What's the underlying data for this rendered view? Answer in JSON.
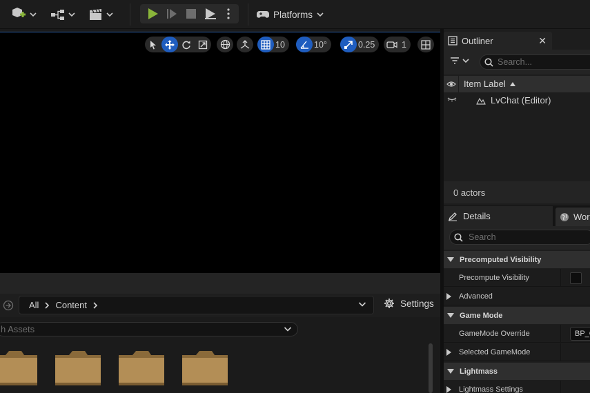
{
  "toolbar": {
    "platforms_label": "Platforms"
  },
  "viewport_toolbar": {
    "grid_snap": "10",
    "rotation_snap": "10°",
    "scale_snap": "0.25",
    "camera_speed": "1"
  },
  "content_browser": {
    "breadcrumb": [
      "All",
      "Content"
    ],
    "settings_label": "Settings",
    "search_placeholder": "Search Assets",
    "search_visible_text": "h Assets"
  },
  "outliner": {
    "tab_label": "Outliner",
    "search_placeholder": "Search...",
    "column_label": "Item Label",
    "items": [
      {
        "label": "LvChat (Editor)"
      }
    ],
    "actor_count": "0 actors"
  },
  "details": {
    "tab_label": "Details",
    "world_tab_label": "Wor",
    "search_placeholder": "Search",
    "sections": {
      "precomputed_visibility": "Precomputed Visibility",
      "precompute_visibility_prop": "Precompute Visibility",
      "advanced": "Advanced",
      "game_mode": "Game Mode",
      "gamemode_override": "GameMode Override",
      "gamemode_override_value": "BP_G",
      "selected_gamemode": "Selected GameMode",
      "lightmass": "Lightmass",
      "lightmass_settings": "Lightmass Settings"
    }
  },
  "colors": {
    "accent_blue": "#1f5dbf",
    "play_green": "#8ab53a",
    "folder_tan": "#b38e56"
  }
}
